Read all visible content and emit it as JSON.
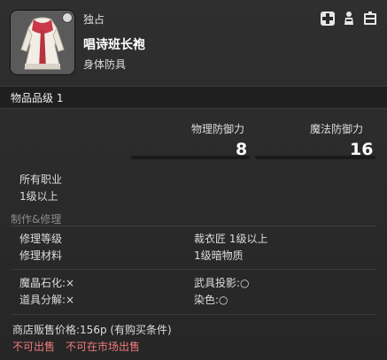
{
  "header": {
    "unique_label": "独占",
    "item_name": "唱诗班长袍",
    "item_category": "身体防具",
    "icons": [
      "plus-cross-icon",
      "glamour-dresser-icon",
      "armoire-icon"
    ]
  },
  "item_level": "物品品级 1",
  "stats": {
    "physical_label": "物理防御力",
    "physical_value": "8",
    "magic_label": "魔法防御力",
    "magic_value": "16"
  },
  "requirements": {
    "classes": "所有职业",
    "level": "1级以上"
  },
  "crafting": {
    "section_title": "制作&修理",
    "repair_level_label": "修理等级",
    "repair_level_value": "裁衣匠 1级以上",
    "repair_material_label": "修理材料",
    "repair_material_value": "1级暗物质",
    "materia_label": "魔晶石化:×",
    "projection_label": "武具投影:○",
    "desynth_label": "道具分解:×",
    "dye_label": "染色:○"
  },
  "shop": {
    "sell_price": "商店贩售价格:156p (有购买条件)",
    "untradeable": "不可出售",
    "market_prohibited": "不可在市场出售"
  },
  "colors": {
    "background": "#2b2b2b",
    "warning": "#f07a7a",
    "section_title": "#8c8c8c"
  }
}
